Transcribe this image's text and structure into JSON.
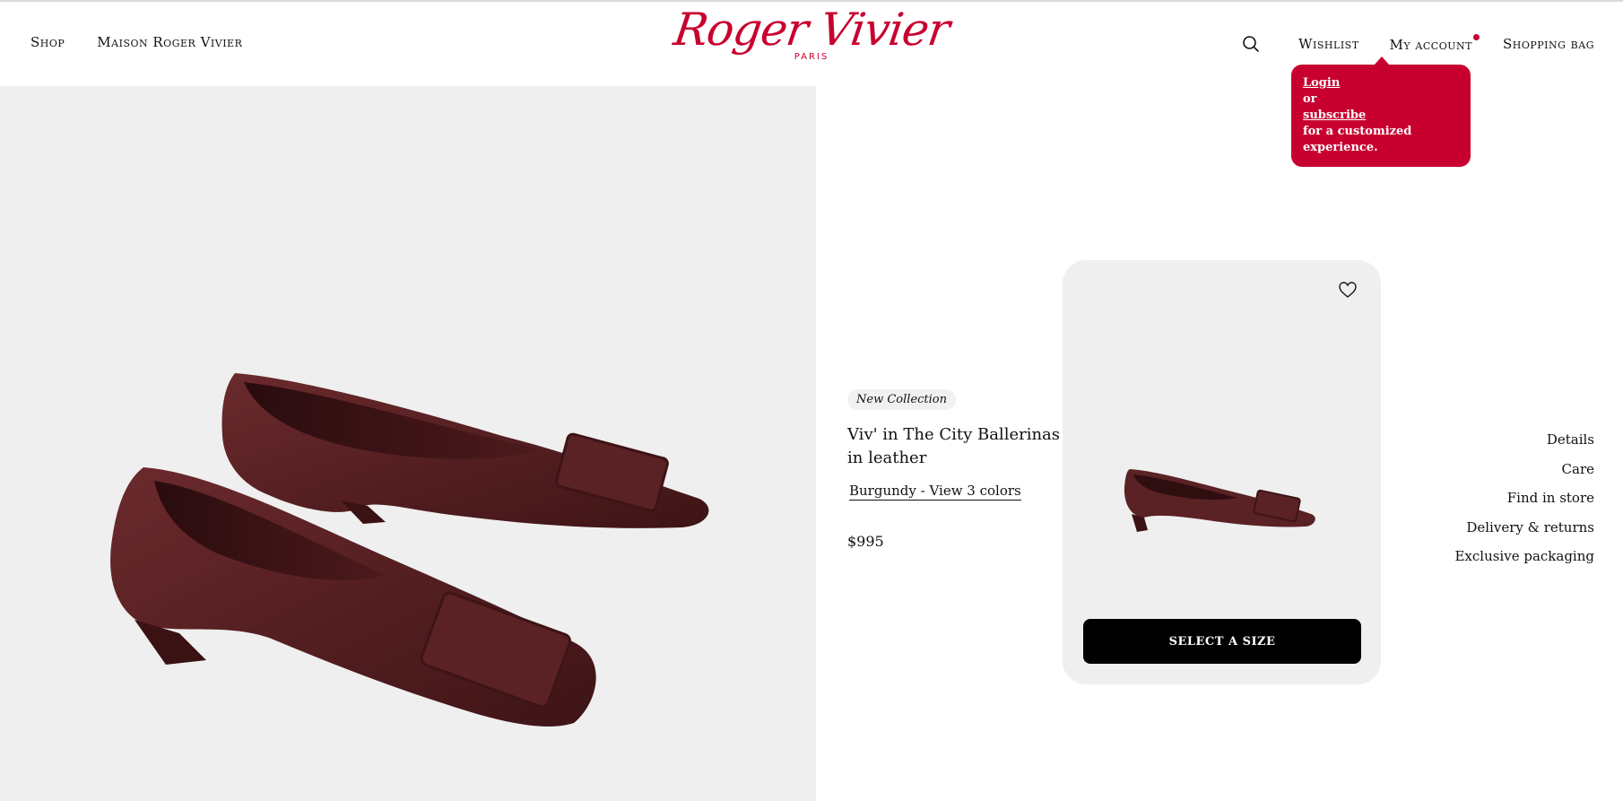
{
  "header": {
    "nav_left": [
      "Shop",
      "Maison Roger Vivier"
    ],
    "logo": {
      "script": "Roger Vivier",
      "sub": "PARIS"
    },
    "nav_right": {
      "wishlist": "Wishlist",
      "account": "My account",
      "bag": "Shopping bag"
    }
  },
  "tooltip": {
    "login": "Login",
    "or": "or",
    "subscribe": "subscribe",
    "line1": "for a customized",
    "line2": "experience."
  },
  "product": {
    "badge": "New Collection",
    "title": "Viv' in The City Ballerinas in leather",
    "color_link": "Burgundy - View 3 colors",
    "price": "$995"
  },
  "card": {
    "button": "SELECT A SIZE"
  },
  "side_links": [
    "Details",
    "Care",
    "Find in store",
    "Delivery & returns",
    "Exclusive packaging"
  ],
  "colors": {
    "brand": "#c8002f",
    "shoe": "#5a2225",
    "background": "#efefef"
  }
}
